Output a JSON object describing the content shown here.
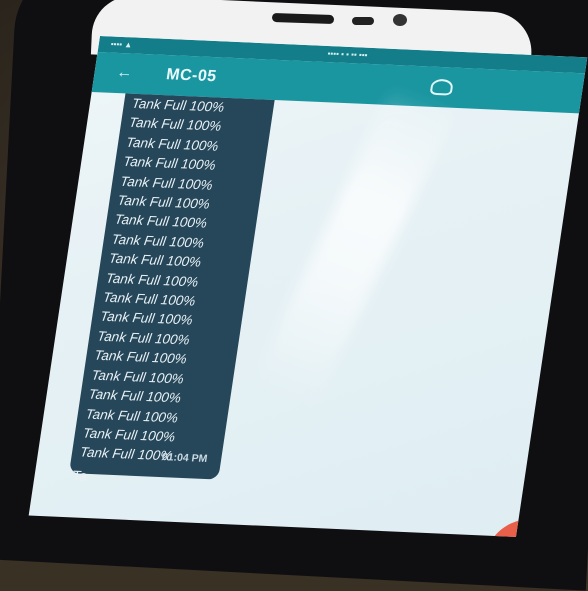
{
  "status_bar": {
    "left": "▪▪▪▪ ▲",
    "right": "▪▪▪▪ ▪ ▪ ▪▪ ▪▪▪"
  },
  "app_bar": {
    "title": "MC-05",
    "back_icon": "back-arrow-icon",
    "call_icon": "phone-icon"
  },
  "message": {
    "lines": [
      "Tank Full 100%",
      "Tank Full 100%",
      "Tank Full 100%",
      "Tank Full 100%",
      "Tank Full 100%",
      "Tank Full 100%",
      "Tank Full 100%",
      "Tank Full 100%",
      "Tank Full 100%",
      "Tank Full 100%",
      "Tank Full 100%",
      "Tank Full 100%",
      "Tank Full 100%",
      "Tank Full 100%",
      "Tank Full 100%",
      "Tank Full 100%",
      "Tank Full 100%",
      "Tank Full 100%",
      "Tank Full 100%"
    ],
    "tail": "Ta",
    "time": "01:04 PM"
  },
  "colors": {
    "app_bar": "#1a96a1",
    "status_bar": "#137e8a",
    "bubble": "#26475a",
    "fab": "#e8604a"
  }
}
